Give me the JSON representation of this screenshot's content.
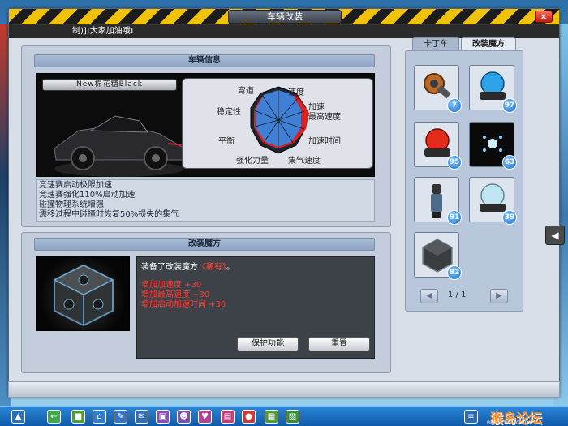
{
  "window": {
    "title": "车辆改装",
    "close_label": "×",
    "chat_message": "制)]!大家加油哦!"
  },
  "vehicle_info": {
    "header": "车辆信息",
    "car_name": "New棉花糖Black",
    "radar_labels": [
      "弯道",
      "速度",
      "加速",
      "最高速度",
      "加速时间",
      "集气速度",
      "强化力量",
      "平衡",
      "稳定性"
    ],
    "description": [
      "竞速赛启动极限加速",
      "竞速赛强化110%启动加速",
      "碰撞物理系统增强",
      "漂移过程中碰撞时恢复50%损失的集气"
    ]
  },
  "magic": {
    "header": "改装魔方",
    "equip_prefix": "装备了改装魔方",
    "equip_rarity": "《稀有》",
    "equip_suffix": "。",
    "stats": [
      "增加加速度 +30",
      "增加最高速度 +30",
      "增加启动加速时间 +30"
    ],
    "protect_button": "保护功能",
    "reset_button": "重置"
  },
  "inventory": {
    "tabs": [
      "卡丁车",
      "改装魔方"
    ],
    "active_tab": 1,
    "items": [
      {
        "icon": "engine-part-icon",
        "count": "7"
      },
      {
        "icon": "blue-dome-icon",
        "count": "97"
      },
      {
        "icon": "red-dome-icon",
        "count": "95"
      },
      {
        "icon": "blue-spark-icon",
        "count": "63"
      },
      {
        "icon": "figure-part-icon",
        "count": "91"
      },
      {
        "icon": "clear-dome-icon",
        "count": "39"
      },
      {
        "icon": "dark-cube-icon",
        "count": "82"
      }
    ],
    "page": "1 / 1",
    "prev_label": "◀",
    "next_label": "▶"
  },
  "side_arrow": "◀",
  "watermark": {
    "text": "猴岛论坛",
    "url": "BBS.HOUDAO.COM"
  },
  "colors": {
    "title_stripe": "#f1c20a",
    "stat_red": "#ff3b30",
    "badge_blue": "#1e6fc7",
    "radar_blue": "#3f7fd6",
    "radar_red": "#e02020"
  }
}
